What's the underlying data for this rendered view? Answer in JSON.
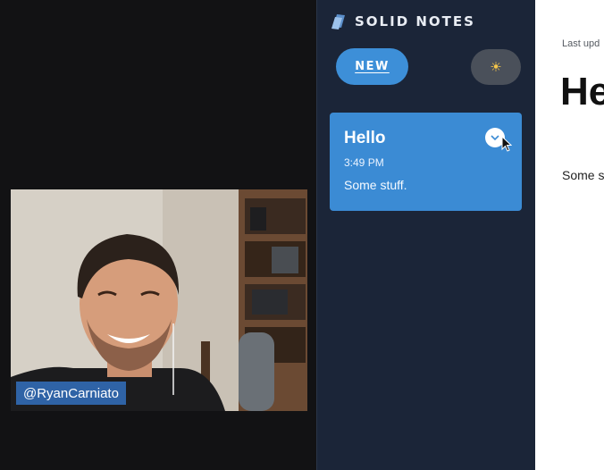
{
  "webcam": {
    "tag": "@RyanCarniato"
  },
  "sidebar": {
    "title": "SOLID NOTES",
    "logo_icon": "paper-stack-icon",
    "new_button_label": "NEW",
    "theme_toggle_icon": "sun-icon",
    "theme_toggle_glyph": "☀",
    "accent_color": "#3b8bd4",
    "background_color": "#1b2538",
    "notes": [
      {
        "title": "Hello",
        "time": "3:49 PM",
        "preview": "Some stuff.",
        "action_icon": "delete-icon"
      }
    ]
  },
  "main": {
    "updated_text": "Last upd",
    "title_text": "He",
    "body_text": "Some s"
  }
}
